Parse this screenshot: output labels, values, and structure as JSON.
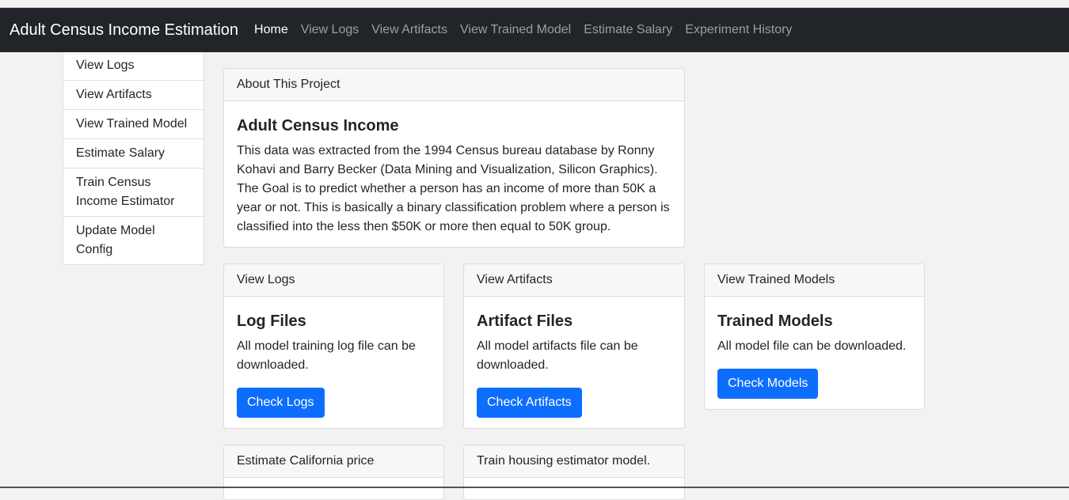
{
  "navbar": {
    "brand": "Adult Census Income Estimation",
    "links": [
      "Home",
      "View Logs",
      "View Artifacts",
      "View Trained Model",
      "Estimate Salary",
      "Experiment History"
    ]
  },
  "sidebar": {
    "items": [
      "View Logs",
      "View Artifacts",
      "View Trained Model",
      "Estimate Salary",
      "Train Census Income Estimator",
      "Update Model Config"
    ]
  },
  "about": {
    "header": "About This Project",
    "title": "Adult Census Income",
    "text": "This data was extracted from the 1994 Census bureau database by Ronny Kohavi and Barry Becker (Data Mining and Visualization, Silicon Graphics). The Goal is to predict whether a person has an income of more than 50K a year or not. This is basically a binary classification problem where a person is classified into the less then $50K or more then equal to 50K group."
  },
  "cards": [
    {
      "header": "View Logs",
      "title": "Log Files",
      "text": "All model training log file can be downloaded.",
      "button": "Check Logs"
    },
    {
      "header": "View Artifacts",
      "title": "Artifact Files",
      "text": "All model artifacts file can be downloaded.",
      "button": "Check Artifacts"
    },
    {
      "header": "View Trained Models",
      "title": "Trained Models",
      "text": "All model file can be downloaded.",
      "button": "Check Models"
    },
    {
      "header": "Estimate California price"
    },
    {
      "header": "Train housing estimator model."
    }
  ],
  "colors": {
    "navbar": "#212529",
    "primary": "#0d6efd",
    "background": "#f2f2f2"
  }
}
